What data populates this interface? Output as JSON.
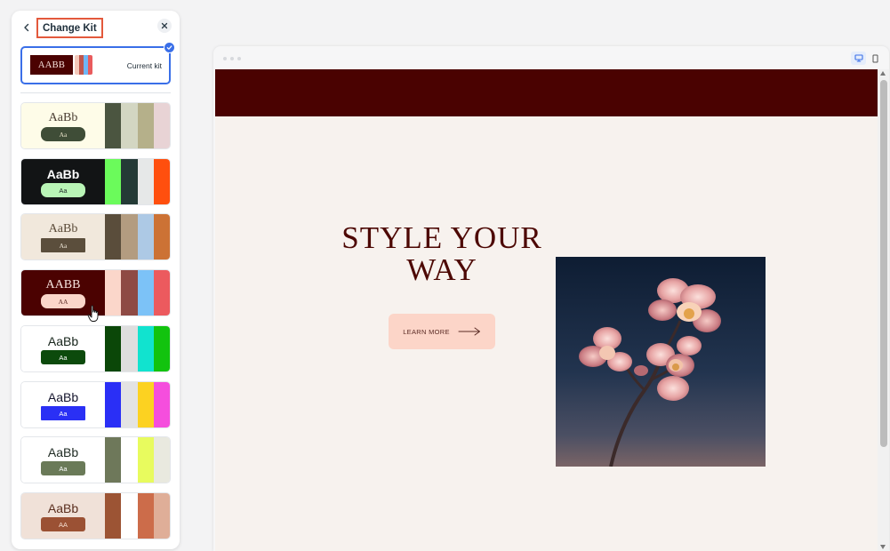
{
  "panel": {
    "title": "Change Kit",
    "current_kit": {
      "label": "Current kit",
      "preview_text": "AABB",
      "bg": "#4b0201",
      "swatches": [
        "#f4c9bb",
        "#c2564c",
        "#6fb6f5",
        "#e95b5d"
      ]
    },
    "kits": [
      {
        "id": "kit-1",
        "heading": "AaBb",
        "button": "Aa",
        "bg": "#fefce8",
        "heading_color": "#4a3d32",
        "btn_bg": "#3f4d37",
        "btn_color": "#e8e2c8",
        "font": "serif",
        "btn_shape": "round",
        "swatches": [
          "#4b5540",
          "#d3d6c2",
          "#b5b08a",
          "#e8d3d5"
        ]
      },
      {
        "id": "kit-2",
        "heading": "AaBb",
        "button": "Aa",
        "bg": "#121415",
        "heading_color": "#ffffff",
        "btn_bg": "#b9f5b6",
        "btn_color": "#1f2a28",
        "font": "sans-bold",
        "btn_shape": "round",
        "swatches": [
          "#6bfb5b",
          "#243a36",
          "#e6e8e8",
          "#ff4f0e"
        ]
      },
      {
        "id": "kit-3",
        "heading": "AaBb",
        "button": "Aa",
        "bg": "#f1e8dc",
        "heading_color": "#5a4a38",
        "btn_bg": "#5b4e3c",
        "btn_color": "#efe7d8",
        "font": "serif",
        "btn_shape": "square",
        "swatches": [
          "#5a4d3b",
          "#b39c80",
          "#adc9e5",
          "#cc7235"
        ]
      },
      {
        "id": "kit-4",
        "heading": "AABB",
        "button": "AA",
        "bg": "#4b0201",
        "heading_color": "#f6e3de",
        "btn_bg": "#fbd6ca",
        "btn_color": "#5a2a24",
        "font": "serif",
        "btn_shape": "round",
        "swatches": [
          "#fbd6ca",
          "#8e4a44",
          "#7cc2f7",
          "#ec5a5e"
        ]
      },
      {
        "id": "kit-5",
        "heading": "AaBb",
        "button": "Aa",
        "bg": "#ffffff",
        "heading_color": "#16241a",
        "btn_bg": "#0c4a0c",
        "btn_color": "#ffffff",
        "font": "sans",
        "btn_shape": "square2",
        "swatches": [
          "#0b4708",
          "#dedede",
          "#11e3cf",
          "#12c30e"
        ]
      },
      {
        "id": "kit-6",
        "heading": "AaBb",
        "button": "Aa",
        "bg": "#ffffff",
        "heading_color": "#16162e",
        "btn_bg": "#2a30f5",
        "btn_color": "#ffffff",
        "font": "sans",
        "btn_shape": "square",
        "swatches": [
          "#2a2ff6",
          "#e3e3e3",
          "#fcd221",
          "#f54edd"
        ]
      },
      {
        "id": "kit-7",
        "heading": "AaBb",
        "button": "Aa",
        "bg": "#ffffff",
        "heading_color": "#1e2a22",
        "btn_bg": "#6a7a58",
        "btn_color": "#ffffff",
        "font": "sans",
        "btn_shape": "square2",
        "swatches": [
          "#6e785a",
          "#ffffff",
          "#e8fb5e",
          "#e9e9df"
        ]
      },
      {
        "id": "kit-8",
        "heading": "AaBb",
        "button": "AA",
        "bg": "#f0e1d8",
        "heading_color": "#5a2e1e",
        "btn_bg": "#9b5134",
        "btn_color": "#f5dccf",
        "font": "sans",
        "btn_shape": "square2",
        "swatches": [
          "#9c5434",
          "#ffffff",
          "#cc6c4a",
          "#dfae98"
        ]
      }
    ]
  },
  "site": {
    "header_color": "#4a0201",
    "hero_title_line1": "STYLE YOUR",
    "hero_title_line2": "WAY",
    "cta_label": "LEARN MORE"
  }
}
